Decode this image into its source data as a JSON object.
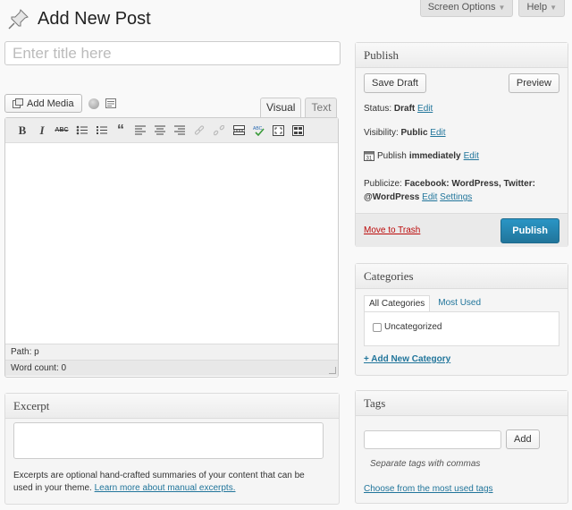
{
  "header": {
    "title": "Add New Post",
    "screen_options": "Screen Options",
    "help": "Help",
    "dropdown_arrow": "▼"
  },
  "post": {
    "title_value": "",
    "title_placeholder": "Enter title here"
  },
  "media": {
    "add_media": "Add Media"
  },
  "editor": {
    "tab_visual": "Visual",
    "tab_text": "Text",
    "toolbar": {
      "bold": "B",
      "italic": "I",
      "strike": "ABC",
      "quote": "“"
    },
    "path": "Path: p",
    "word_count": "Word count: 0"
  },
  "excerpt": {
    "heading": "Excerpt",
    "value": "",
    "note": "Excerpts are optional hand-crafted summaries of your content that can be used in your theme.",
    "learn_more": "Learn more about manual excerpts."
  },
  "publish": {
    "heading": "Publish",
    "save_draft": "Save Draft",
    "preview": "Preview",
    "status_label": "Status:",
    "status_value": "Draft",
    "visibility_label": "Visibility:",
    "visibility_value": "Public",
    "publish_label": "Publish",
    "publish_value": "immediately",
    "publicize_label": "Publicize:",
    "publicize_value": "Facebook: WordPress, Twitter: @WordPress",
    "edit": "Edit",
    "settings": "Settings",
    "move_to_trash": "Move to Trash",
    "publish_button": "Publish"
  },
  "categories": {
    "heading": "Categories",
    "tab_all": "All Categories",
    "tab_most_used": "Most Used",
    "items": [
      "Uncategorized"
    ],
    "add_new": "+ Add New Category"
  },
  "tags": {
    "heading": "Tags",
    "input_value": "",
    "add": "Add",
    "hint": "Separate tags with commas",
    "choose": "Choose from the most used tags"
  },
  "colors": {
    "link": "#21759b",
    "publish_button": "#21759b",
    "trash": "#bc0b0b"
  }
}
